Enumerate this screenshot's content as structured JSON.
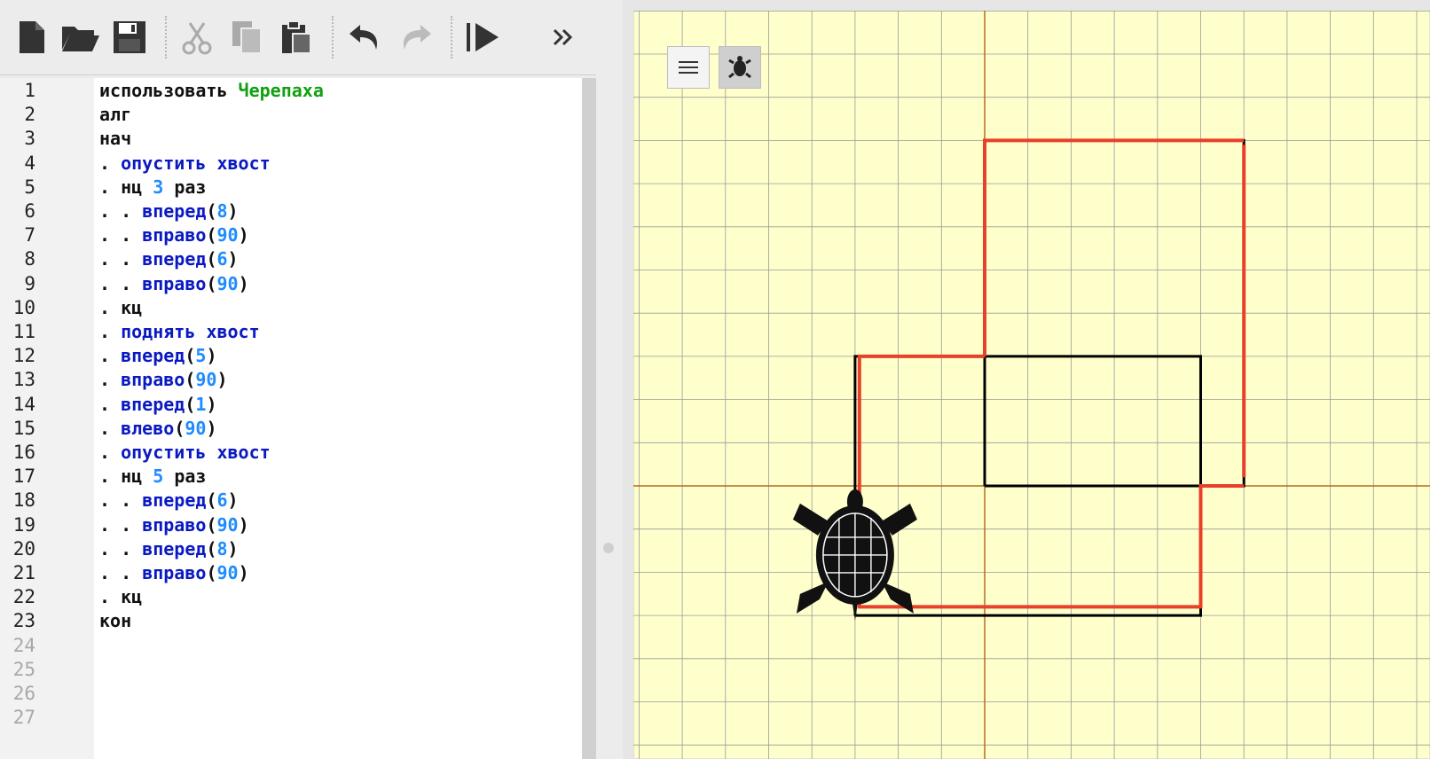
{
  "toolbar": {
    "buttons": [
      {
        "name": "new-file-icon"
      },
      {
        "name": "open-folder-icon"
      },
      {
        "name": "save-icon"
      },
      {
        "name": "cut-icon"
      },
      {
        "name": "copy-icon"
      },
      {
        "name": "paste-icon"
      },
      {
        "name": "undo-icon"
      },
      {
        "name": "redo-icon"
      },
      {
        "name": "run-icon"
      },
      {
        "name": "more-icon"
      }
    ]
  },
  "editor": {
    "line_numbers": [
      "1",
      "2",
      "3",
      "4",
      "5",
      "6",
      "7",
      "8",
      "9",
      "10",
      "11",
      "12",
      "13",
      "14",
      "15",
      "16",
      "17",
      "18",
      "19",
      "20",
      "21",
      "22",
      "23",
      "24",
      "25",
      "26",
      "27"
    ],
    "lines": [
      "использовать Черепаха",
      "алг",
      "нач",
      ". опустить хвост",
      ". нц 3 раз",
      ". . вперед(8)",
      ". . вправо(90)",
      ". . вперед(6)",
      ". . вправо(90)",
      ". кц",
      ". поднять хвост",
      ". вперед(5)",
      ". вправо(90)",
      ". вперед(1)",
      ". влево(90)",
      ". опустить хвост",
      ". нц 5 раз",
      ". . вперед(6)",
      ". . вправо(90)",
      ". . вперед(8)",
      ". . вправо(90)",
      ". кц",
      "кон"
    ]
  },
  "canvas": {
    "controls": [
      {
        "name": "menu-icon"
      },
      {
        "name": "turtle-icon"
      }
    ],
    "colors": {
      "background": "#ffffcc",
      "grid": "#9a9a9a",
      "axes": "#b36a1e",
      "black_path": "#000000",
      "red_path": "#e8402a"
    }
  }
}
